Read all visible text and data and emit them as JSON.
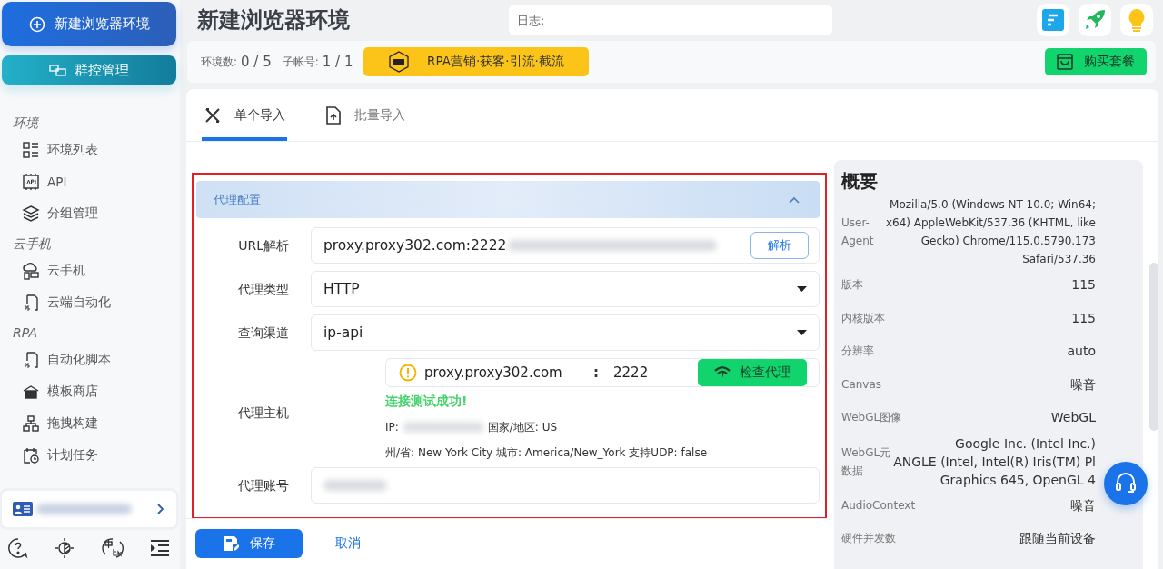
{
  "sidebar": {
    "new_button": "新建浏览器环境",
    "group_button": "群控管理",
    "sections": [
      {
        "title": "环境",
        "items": [
          {
            "label": "环境列表"
          },
          {
            "label": "API"
          },
          {
            "label": "分组管理"
          }
        ]
      },
      {
        "title": "云手机",
        "items": [
          {
            "label": "云手机"
          },
          {
            "label": "云端自动化"
          }
        ]
      },
      {
        "title": "RPA",
        "items": [
          {
            "label": "自动化脚本"
          },
          {
            "label": "模板商店"
          },
          {
            "label": "拖拽构建"
          },
          {
            "label": "计划任务"
          }
        ]
      }
    ]
  },
  "header": {
    "title": "新建浏览器环境",
    "log_placeholder": "日志:"
  },
  "stats": {
    "env_label": "环境数:",
    "env_value": "0 / 5",
    "sub_label": "子帐号:",
    "sub_value": "1 / 1",
    "promo": "RPA营销·获客·引流·截流",
    "buy": "购买套餐"
  },
  "tabs": [
    {
      "label": "单个导入",
      "selected": true
    },
    {
      "label": "批量导入",
      "selected": false
    }
  ],
  "proxy": {
    "title": "代理配置",
    "expanded": true,
    "url_label": "URL解析",
    "url_value": "proxy.proxy302.com:2222",
    "parse_button": "解析",
    "type_label": "代理类型",
    "type_value": "HTTP",
    "channel_label": "查询渠道",
    "channel_value": "ip-api",
    "host_label": "代理主机",
    "host": "proxy.proxy302.com",
    "separator": ":",
    "port": "2222",
    "check_button": "检查代理",
    "success": "连接测试成功!",
    "ip_label": "IP:",
    "country": "国家/地区: US",
    "location": "州/省: New York City 城市: America/New_York 支持UDP: false",
    "account_label": "代理账号"
  },
  "footer": {
    "save": "保存",
    "cancel": "取消"
  },
  "summary": {
    "title": "概要",
    "rows": [
      {
        "label": "User-Agent",
        "value": [
          "Mozilla/5.0 (Windows NT 10.0; Win64;",
          "x64) AppleWebKit/537.36 (KHTML, like",
          "Gecko) Chrome/115.0.5790.173",
          "Safari/537.36"
        ]
      },
      {
        "label": "版本",
        "value": [
          "115"
        ]
      },
      {
        "label": "内核版本",
        "value": [
          "115"
        ]
      },
      {
        "label": "分辨率",
        "value": [
          "auto"
        ]
      },
      {
        "label": "Canvas",
        "value": [
          "噪音"
        ]
      },
      {
        "label": "WebGL图像",
        "value": [
          "WebGL"
        ]
      },
      {
        "label": "WebGL元数据",
        "value": [
          "Google Inc. (Intel Inc.)",
          "ANGLE (Intel, Intel(R) Iris(TM) Pl",
          "Graphics 645, OpenGL 4"
        ]
      },
      {
        "label": "AudioContext",
        "value": [
          "噪音"
        ]
      },
      {
        "label": "硬件并发数",
        "value": [
          "跟随当前设备"
        ]
      }
    ]
  }
}
